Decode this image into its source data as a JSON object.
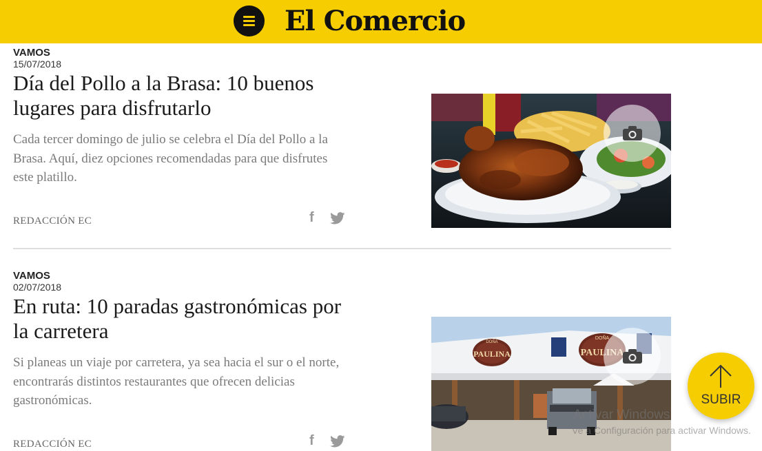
{
  "header": {
    "logo": "El Comercio",
    "menu_icon": "hamburger-menu-icon",
    "brand_color": "#f5cd00"
  },
  "articles": [
    {
      "section": "VAMOS",
      "date": "15/07/2018",
      "headline": "Día del Pollo a la Brasa: 10 buenos lugares para disfrutarlo",
      "summary": "Cada tercer domingo de julio se celebra el Día del Pollo a la Brasa. Aquí, diez opciones recomendadas para que disfrutes este platillo.",
      "author": "REDACCIÓN EC",
      "share_icons": [
        "facebook-icon",
        "twitter-icon"
      ],
      "gallery_icon": "camera-icon"
    },
    {
      "section": "VAMOS",
      "date": "02/07/2018",
      "headline": "En ruta: 10 paradas gastronómicas por la carretera",
      "summary": "Si planeas un viaje por carretera, ya sea hacia el sur o el norte, encontrarás distintos restaurantes que ofrecen delicias gastronómicas.",
      "author": "REDACCIÓN EC",
      "share_icons": [
        "facebook-icon",
        "twitter-icon"
      ],
      "gallery_icon": "camera-icon",
      "image_signs": [
        "DOÑA",
        "PAULINA"
      ]
    }
  ],
  "scroll_top": {
    "label": "SUBIR",
    "icon": "arrow-up-icon"
  },
  "os_overlay": {
    "line1": "Activar Windows",
    "line2": "Ve a Configuración para activar Windows."
  }
}
